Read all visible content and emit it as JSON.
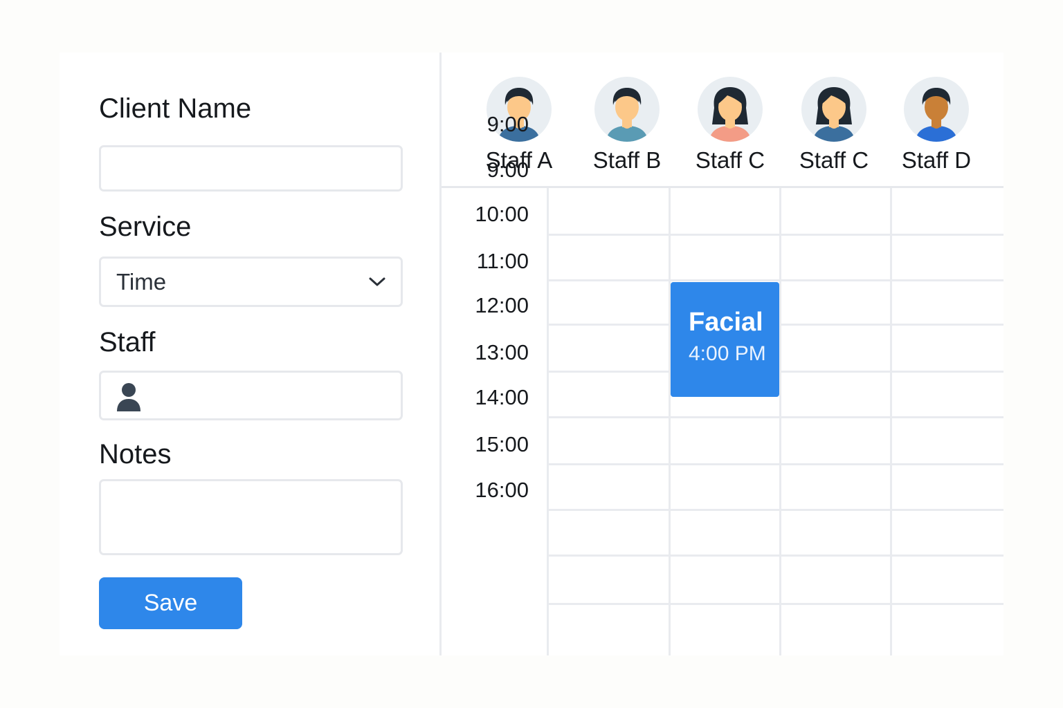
{
  "form": {
    "client_name": {
      "label": "Client Name",
      "value": "",
      "placeholder": ""
    },
    "service": {
      "label": "Service",
      "value": "Time",
      "icon": "chevron-down-icon"
    },
    "staff": {
      "label": "Staff",
      "value": "",
      "icon": "person-icon"
    },
    "notes": {
      "label": "Notes",
      "value": "",
      "placeholder": ""
    },
    "save_label": "Save"
  },
  "staff_columns": [
    {
      "name": "Staff A",
      "skin": "#fcc889",
      "hair": "#1f2933",
      "shirt": "#3b6f9e",
      "long_hair": false
    },
    {
      "name": "Staff B",
      "skin": "#fcc889",
      "hair": "#1f2933",
      "shirt": "#5a9bb4",
      "long_hair": false
    },
    {
      "name": "Staff C",
      "skin": "#fcc889",
      "hair": "#1f2933",
      "shirt": "#f39c86",
      "long_hair": true
    },
    {
      "name": "Staff C",
      "skin": "#fcc889",
      "hair": "#1f2933",
      "shirt": "#3b6f9e",
      "long_hair": true
    },
    {
      "name": "Staff D",
      "skin": "#c98037",
      "hair": "#1f2933",
      "shirt": "#2b6fd6",
      "long_hair": false
    }
  ],
  "times": [
    "9:00",
    "9:00",
    "10:00",
    "11:00",
    "12:00",
    "13:00",
    "14:00",
    "15:00",
    "16:00"
  ],
  "appointment": {
    "title": "Facial",
    "time": "4:00 PM",
    "color": "#2e87ea"
  },
  "colors": {
    "accent": "#2e87ea",
    "avatar_bg": "#e9eef2",
    "grid": "#e9ebef"
  }
}
